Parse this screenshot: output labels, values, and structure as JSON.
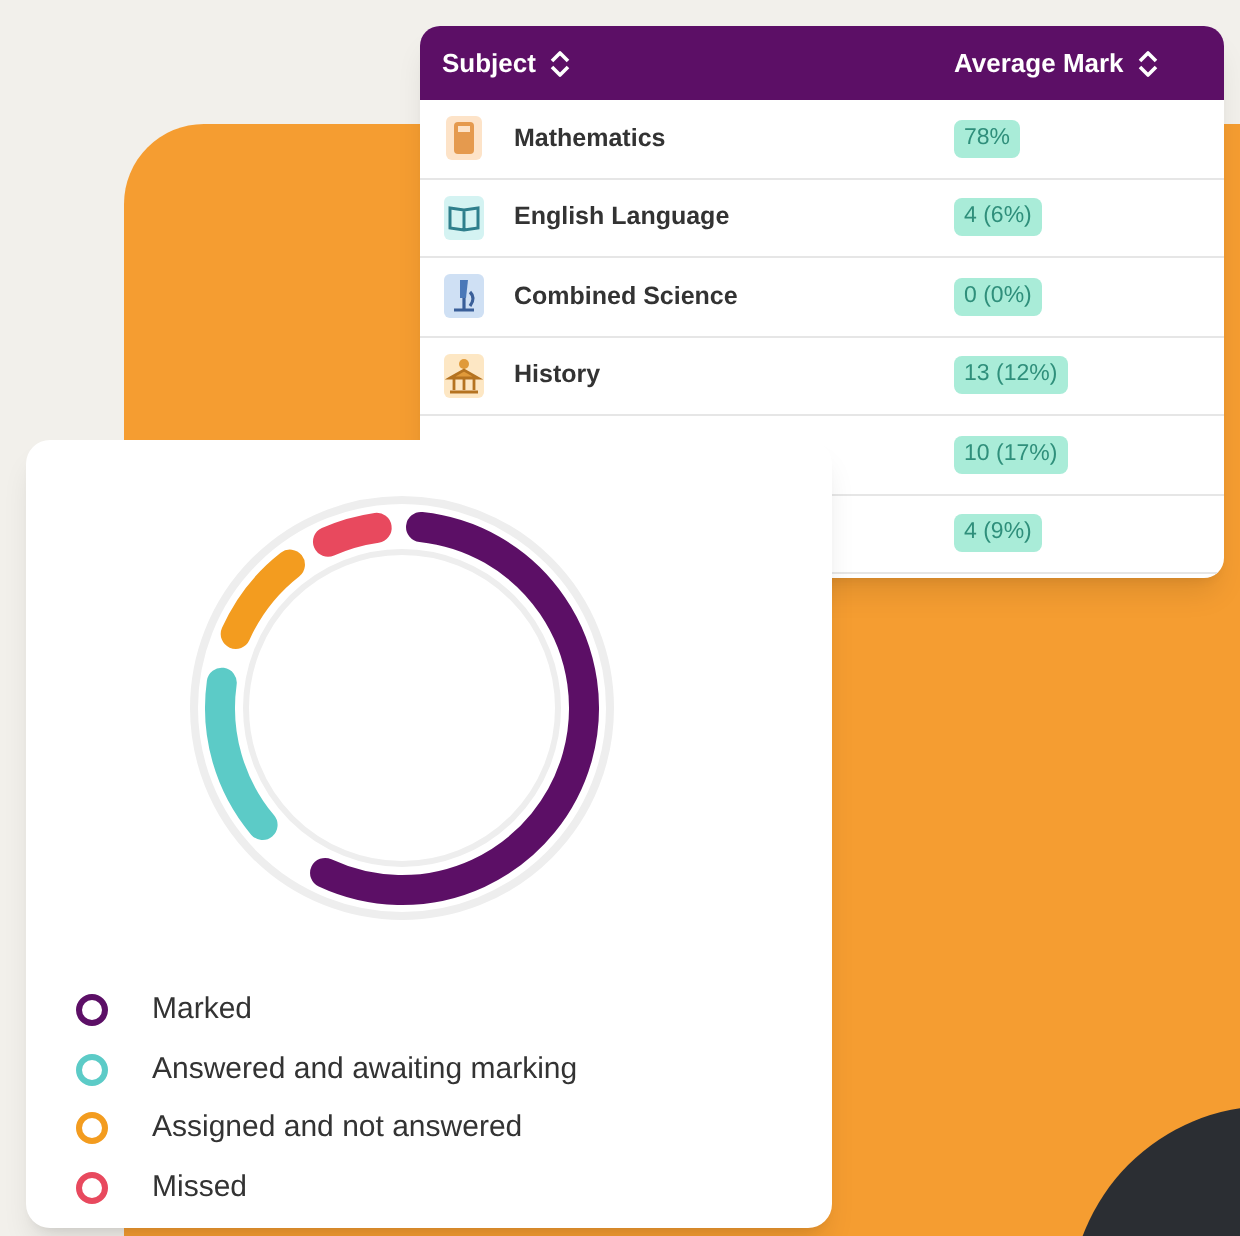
{
  "table": {
    "columns": [
      {
        "label": "Subject"
      },
      {
        "label": "Average Mark"
      }
    ],
    "rows": [
      {
        "kind": "calculator",
        "subject": "Mathematics",
        "mark": "78%"
      },
      {
        "kind": "book",
        "subject": "English Language",
        "mark": "4 (6%)"
      },
      {
        "kind": "microscope",
        "subject": "Combined Science",
        "mark": "0 (0%)"
      },
      {
        "kind": "monument",
        "subject": "History",
        "mark": "13 (12%)"
      },
      {
        "mark": "10 (17%)"
      },
      {
        "mark": "4 (9%)"
      }
    ]
  },
  "legend": [
    {
      "label": "Marked",
      "color": "#5c0f66"
    },
    {
      "label": "Answered and awaiting marking",
      "color": "#5ccbc7"
    },
    {
      "label": "Assigned and not answered",
      "color": "#f39c1f"
    },
    {
      "label": "Missed",
      "color": "#e8495e"
    }
  ]
}
